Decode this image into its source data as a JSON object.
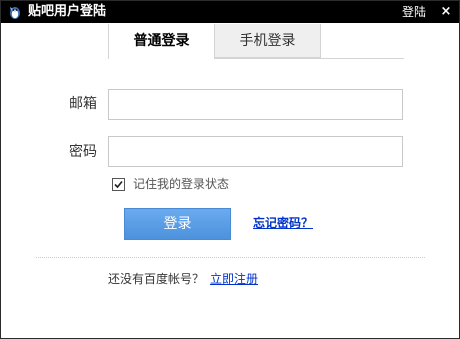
{
  "window": {
    "title": "贴吧用户登陆",
    "title_login_label": "登陆",
    "close_label": "×",
    "app_icon": "tieba-penguin-icon"
  },
  "tabs": [
    {
      "label": "普通登录",
      "active": true
    },
    {
      "label": "手机登录",
      "active": false
    }
  ],
  "form": {
    "email_label": "邮箱",
    "email_value": "",
    "password_label": "密码",
    "password_value": "",
    "remember_label": "记住我的登录状态",
    "remember_checked": true,
    "login_button": "登录",
    "forgot_link": "忘记密码？"
  },
  "footer": {
    "no_account_text": "还没有百度帐号？",
    "register_link": "立即注册"
  },
  "colors": {
    "titlebar": "#000000",
    "button": "#5a9ee6",
    "link": "#0033cc"
  }
}
